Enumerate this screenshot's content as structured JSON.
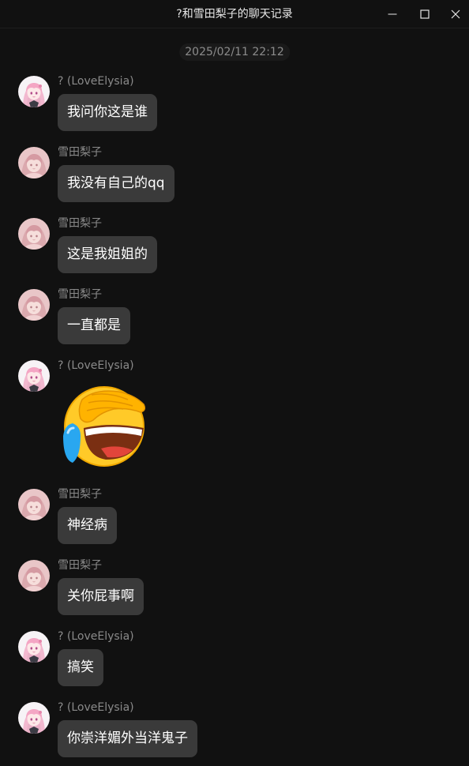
{
  "window": {
    "title": "?和雪田梨子的聊天记录",
    "controls": [
      "minimize-icon",
      "maximize-icon",
      "close-icon"
    ]
  },
  "timestamp": "2025/02/11 22:12",
  "colors": {
    "background": "#111111",
    "bubble": "#3a3a3a",
    "sender_text": "#8a8a8a",
    "message_text": "#ffffff"
  },
  "messages": [
    {
      "sender": "? (LoveElysia)",
      "avatar": "anime-avatar-love-elysia",
      "type": "text",
      "text": "我问你这是谁"
    },
    {
      "sender": "雪田梨子",
      "avatar": "anime-avatar-yukida-riko",
      "type": "text",
      "text": "我没有自己的qq"
    },
    {
      "sender": "雪田梨子",
      "avatar": "anime-avatar-yukida-riko",
      "type": "text",
      "text": "这是我姐姐的"
    },
    {
      "sender": "雪田梨子",
      "avatar": "anime-avatar-yukida-riko",
      "type": "text",
      "text": "一直都是"
    },
    {
      "sender": "? (LoveElysia)",
      "avatar": "anime-avatar-love-elysia",
      "type": "sticker",
      "sticker": "facepalm-laughing-crying-emoji"
    },
    {
      "sender": "雪田梨子",
      "avatar": "anime-avatar-yukida-riko",
      "type": "text",
      "text": "神经病"
    },
    {
      "sender": "雪田梨子",
      "avatar": "anime-avatar-yukida-riko",
      "type": "text",
      "text": "关你屁事啊"
    },
    {
      "sender": "? (LoveElysia)",
      "avatar": "anime-avatar-love-elysia",
      "type": "text",
      "text": "搞笑"
    },
    {
      "sender": "? (LoveElysia)",
      "avatar": "anime-avatar-love-elysia",
      "type": "text",
      "text": "你崇洋媚外当洋鬼子"
    }
  ]
}
